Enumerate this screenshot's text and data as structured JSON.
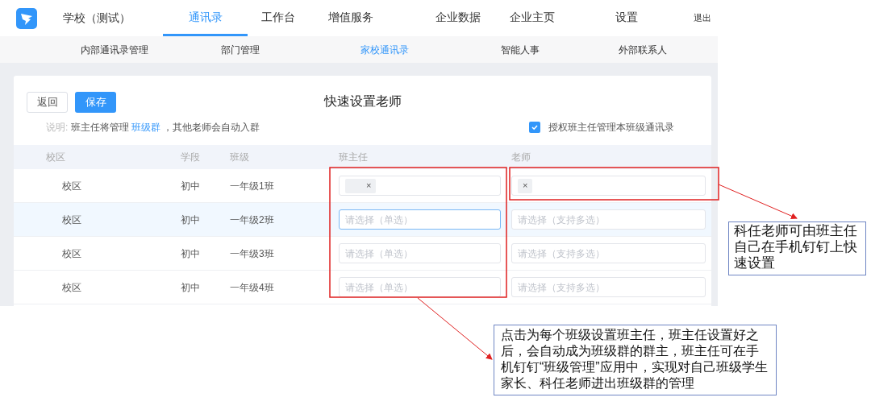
{
  "header": {
    "school_name": "学校（测试）",
    "logout": "退出"
  },
  "nav_tabs": [
    {
      "label": "通讯录",
      "selected": true
    },
    {
      "label": "工作台",
      "selected": false
    },
    {
      "label": "增值服务",
      "selected": false
    },
    {
      "label": "企业数据",
      "selected": false
    },
    {
      "label": "企业主页",
      "selected": false
    },
    {
      "label": "设置",
      "selected": false
    }
  ],
  "sub_tabs": [
    {
      "label": "内部通讯录管理",
      "selected": false
    },
    {
      "label": "部门管理",
      "selected": false
    },
    {
      "label": "家校通讯录",
      "selected": true
    },
    {
      "label": "智能人事",
      "selected": false
    },
    {
      "label": "外部联系人",
      "selected": false
    }
  ],
  "page": {
    "back_button": "返回",
    "save_button": "保存",
    "title": "快速设置老师",
    "note": {
      "label": "说明:",
      "before": "班主任将管理",
      "link": "班级群",
      "after": "，其他老师会自动入群"
    },
    "checkbox": {
      "label": "授权班主任管理本班级通讯录",
      "checked": true
    }
  },
  "table": {
    "columns": [
      "校区",
      "学段",
      "班级",
      "班主任",
      "老师"
    ],
    "rows": [
      {
        "campus": "校区",
        "stage": "初中",
        "class": "一年级1班",
        "highlighted": false,
        "head_teacher": {
          "kind": "chip",
          "remove": "×",
          "focused": false
        },
        "teachers": {
          "kind": "chip",
          "remove": "×",
          "focused": false
        }
      },
      {
        "campus": "校区",
        "stage": "初中",
        "class": "一年级2班",
        "highlighted": true,
        "head_teacher": {
          "kind": "empty",
          "placeholder": "请选择（单选）",
          "focused": true
        },
        "teachers": {
          "kind": "empty",
          "placeholder": "请选择（支持多选）",
          "focused": false
        }
      },
      {
        "campus": "校区",
        "stage": "初中",
        "class": "一年级3班",
        "highlighted": false,
        "head_teacher": {
          "kind": "empty",
          "placeholder": "请选择（单选）",
          "focused": false
        },
        "teachers": {
          "kind": "empty",
          "placeholder": "请选择（支持多选）",
          "focused": false
        }
      },
      {
        "campus": "校区",
        "stage": "初中",
        "class": "一年级4班",
        "highlighted": false,
        "head_teacher": {
          "kind": "empty",
          "placeholder": "请选择（单选）",
          "focused": false
        },
        "teachers": {
          "kind": "empty",
          "placeholder": "请选择（支持多选）",
          "focused": false
        }
      }
    ]
  },
  "annotations": [
    {
      "text": "科任老师可由班主任自己在手机钉钉上快速设置"
    },
    {
      "text": "点击为每个班级设置班主任，班主任设置好之后，会自动成为班级群的群主，班主任可在手机钉钉“班级管理”应用中，实现对自己班级学生家长、科任老师进出班级群的管理"
    }
  ]
}
